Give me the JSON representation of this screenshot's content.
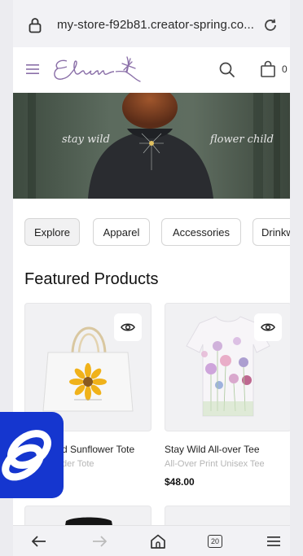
{
  "browser": {
    "url": "my-store-f92b81.creator-spring.co...",
    "tab_count": "20"
  },
  "header": {
    "logo_text": "Eden",
    "cart_count": "0"
  },
  "hero": {
    "left_text": "stay wild",
    "right_text": "flower child"
  },
  "categories": [
    "Explore",
    "Apparel",
    "Accessories",
    "Drinkw"
  ],
  "featured": {
    "title": "Featured Products",
    "products": [
      {
        "name": "Stay Wild Sunflower Tote",
        "visible_name": "d Sunflower Tote",
        "type": "der Tote",
        "price": ""
      },
      {
        "name": "Stay Wild All-over Tee",
        "visible_name": "Stay Wild All-over Tee",
        "type": "All-Over Print Unisex Tee",
        "price": "$48.00"
      }
    ]
  },
  "colors": {
    "accent_purple": "#8a6fa8",
    "badge_blue": "#1536cf"
  },
  "icons": [
    "lock-icon",
    "reload-icon",
    "menu-icon",
    "search-icon",
    "bag-icon",
    "eye-icon",
    "back-icon",
    "forward-icon",
    "home-icon",
    "tabs-icon",
    "browser-menu-icon"
  ]
}
